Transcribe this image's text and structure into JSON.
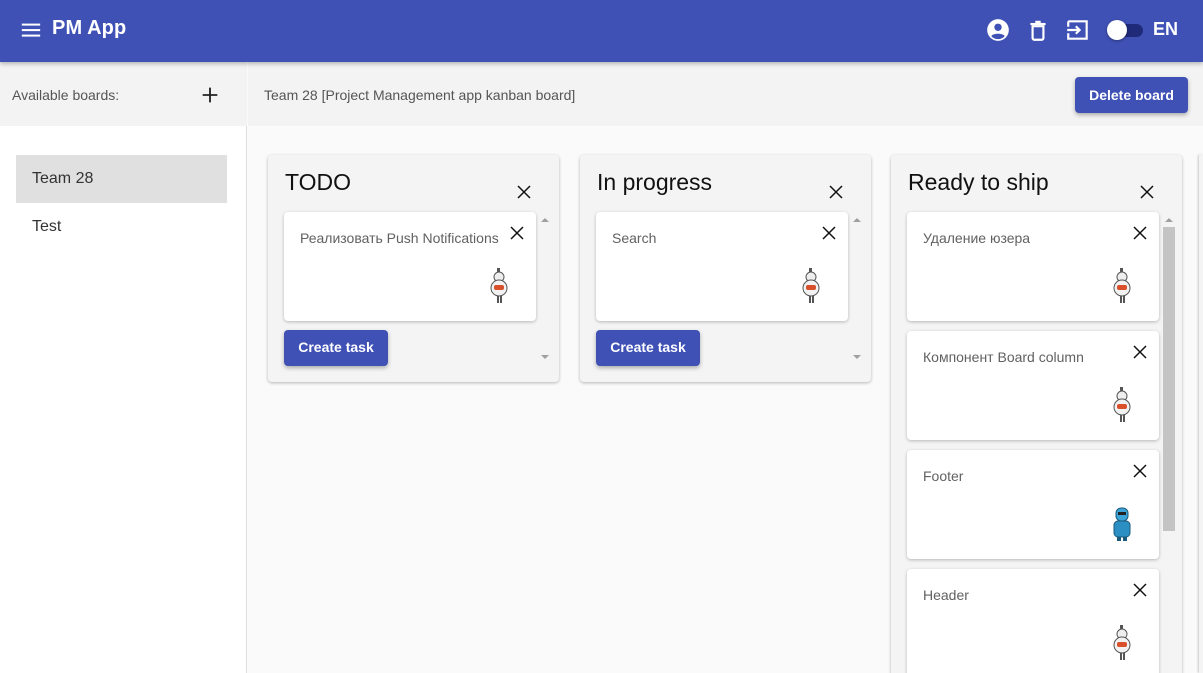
{
  "app": {
    "title": "PM App",
    "language": "EN"
  },
  "icons": {
    "menu": "menu-icon",
    "profile": "account-circle-icon",
    "trash": "trash-icon",
    "logout": "logout-icon",
    "add": "plus-icon",
    "close": "close-icon",
    "avatar": "user-avatar-icon"
  },
  "colors": {
    "primary": "#3f51b5",
    "active_board": "#e0e0e0",
    "theme_toggle_on": true
  },
  "sidebar": {
    "heading": "Available boards:",
    "boards": [
      {
        "label": "Team 28",
        "active": true
      },
      {
        "label": "Test",
        "active": false
      }
    ]
  },
  "board": {
    "title": "Team 28 [Project Management app kanban board]",
    "delete_label": "Delete board",
    "columns": [
      {
        "title": "TODO",
        "create_label": "Create task",
        "tasks": [
          {
            "title": "Реализовать Push Notifications",
            "avatar": "robot"
          }
        ]
      },
      {
        "title": "In progress",
        "create_label": "Create task",
        "tasks": [
          {
            "title": "Search",
            "avatar": "robot"
          }
        ]
      },
      {
        "title": "Ready to ship",
        "tasks": [
          {
            "title": "Удаление юзера",
            "avatar": "robot"
          },
          {
            "title": "Компонент Board column",
            "avatar": "robot"
          },
          {
            "title": "Footer",
            "avatar": "blue-robot"
          },
          {
            "title": "Header",
            "avatar": "robot"
          }
        ]
      }
    ]
  }
}
